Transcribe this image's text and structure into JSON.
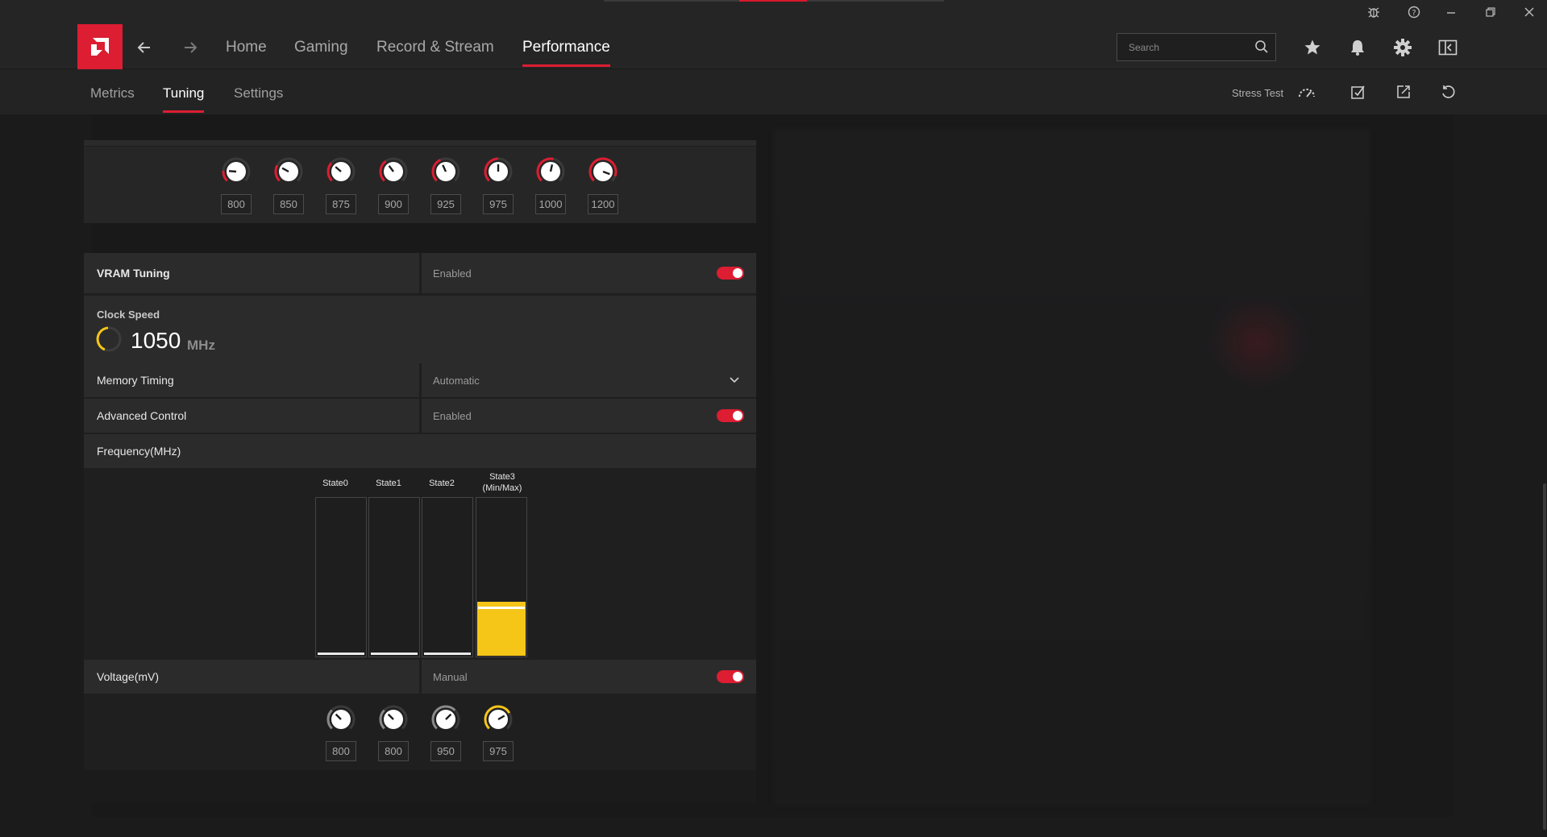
{
  "nav": {
    "home": "Home",
    "gaming": "Gaming",
    "record_stream": "Record & Stream",
    "performance": "Performance",
    "search_placeholder": "Search"
  },
  "subnav": {
    "metrics": "Metrics",
    "tuning": "Tuning",
    "settings": "Settings",
    "stress_test": "Stress Test"
  },
  "top_voltage_knobs": {
    "values": [
      "800",
      "850",
      "875",
      "900",
      "925",
      "975",
      "1000",
      "1200"
    ]
  },
  "vram": {
    "title": "VRAM Tuning",
    "status": "Enabled",
    "enabled": true,
    "clock_label": "Clock Speed",
    "clock_value": "1050",
    "clock_unit": "MHz",
    "memory_timing_label": "Memory Timing",
    "memory_timing_value": "Automatic",
    "advanced_control_label": "Advanced Control",
    "advanced_control_value": "Enabled",
    "frequency_label": "Frequency(MHz)",
    "states": [
      {
        "label": "State0",
        "sublabel": ""
      },
      {
        "label": "State1",
        "sublabel": ""
      },
      {
        "label": "State2",
        "sublabel": ""
      },
      {
        "label": "State3",
        "sublabel": "(Min/Max)"
      }
    ],
    "state_fill_fraction": [
      0,
      0,
      0,
      0.34
    ],
    "voltage_label": "Voltage(mV)",
    "voltage_mode": "Manual",
    "voltage_knobs": [
      "800",
      "800",
      "950",
      "975"
    ]
  },
  "colors": {
    "accent": "#dc1d32",
    "highlight": "#f5c518",
    "background": "#1b1b1c",
    "panel": "#2b2b2c"
  },
  "icons": [
    "amd-logo-icon",
    "back-arrow-icon",
    "forward-arrow-icon",
    "search-icon",
    "star-icon",
    "bell-icon",
    "gear-icon",
    "sidebar-toggle-icon",
    "bug-icon",
    "help-icon",
    "minimize-icon",
    "restore-icon",
    "close-icon",
    "stress-gauge-icon",
    "checklist-icon",
    "export-icon",
    "reset-icon",
    "chevron-down-icon"
  ]
}
